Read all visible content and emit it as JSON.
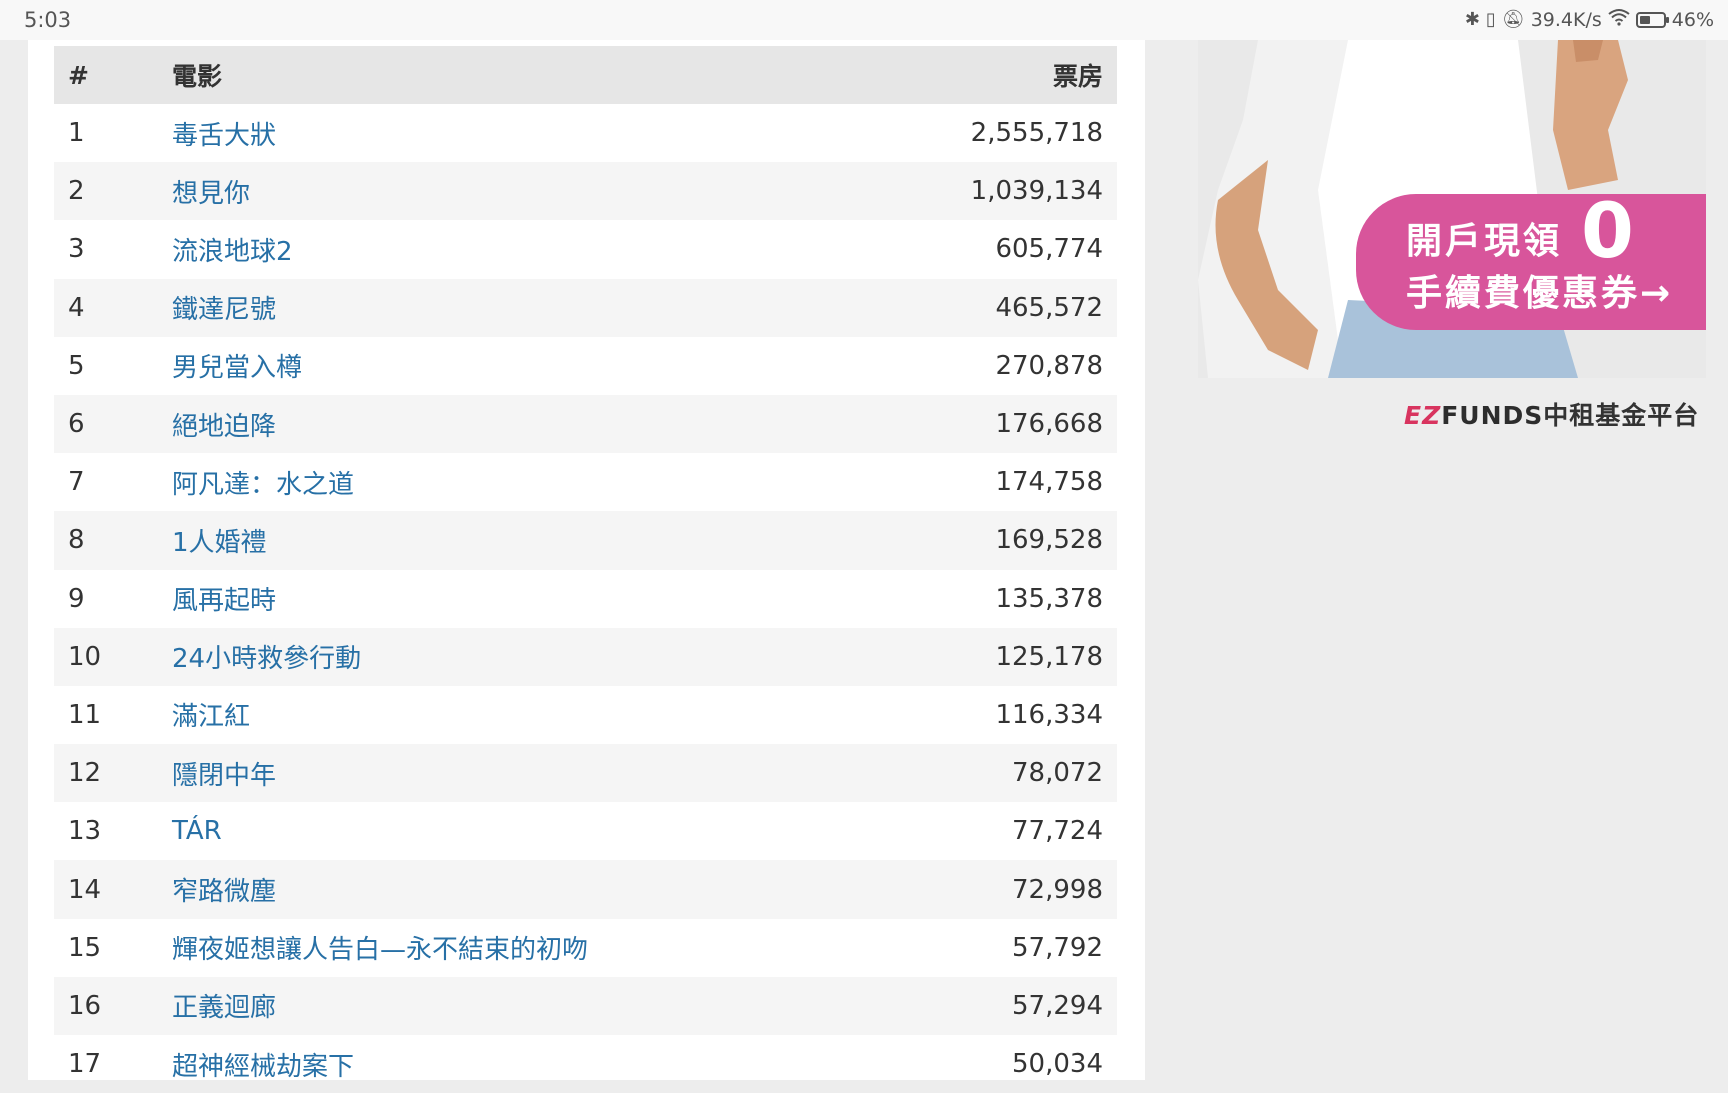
{
  "status_bar": {
    "time": "5:03",
    "network_speed": "39.4K/s",
    "battery": "46%",
    "battery_level": 0.46,
    "icons": [
      "bluetooth-icon",
      "vibrate-icon",
      "mute-icon",
      "wifi-icon",
      "battery-icon"
    ]
  },
  "table": {
    "headers": {
      "rank": "#",
      "title": "電影",
      "gross": "票房"
    },
    "rows": [
      {
        "rank": "1",
        "title": "毒舌大狀",
        "gross": "2,555,718"
      },
      {
        "rank": "2",
        "title": "想見你",
        "gross": "1,039,134"
      },
      {
        "rank": "3",
        "title": "流浪地球2",
        "gross": "605,774"
      },
      {
        "rank": "4",
        "title": "鐵達尼號",
        "gross": "465,572"
      },
      {
        "rank": "5",
        "title": "男兒當入樽",
        "gross": "270,878"
      },
      {
        "rank": "6",
        "title": "絕地迫降",
        "gross": "176,668"
      },
      {
        "rank": "7",
        "title": "阿凡達：水之道",
        "gross": "174,758"
      },
      {
        "rank": "8",
        "title": "1人婚禮",
        "gross": "169,528"
      },
      {
        "rank": "9",
        "title": "風再起時",
        "gross": "135,378"
      },
      {
        "rank": "10",
        "title": "24小時救參行動",
        "gross": "125,178"
      },
      {
        "rank": "11",
        "title": "滿江紅",
        "gross": "116,334"
      },
      {
        "rank": "12",
        "title": "隱閉中年",
        "gross": "78,072"
      },
      {
        "rank": "13",
        "title": "TÁR",
        "gross": "77,724"
      },
      {
        "rank": "14",
        "title": "窄路微塵",
        "gross": "72,998"
      },
      {
        "rank": "15",
        "title": "輝夜姬想讓人告白—永不結束的初吻",
        "gross": "57,792"
      },
      {
        "rank": "16",
        "title": "正義迴廊",
        "gross": "57,294"
      },
      {
        "rank": "17",
        "title": "超神經械劫案下",
        "gross": "50,034"
      }
    ]
  },
  "ad": {
    "promo_line1": "開戶現領",
    "promo_zero": "0",
    "promo_line2": "手續費優惠券→",
    "logo_ez": "EZ",
    "logo_funds": "FUNDS",
    "logo_cn": "中租基金平台",
    "colors": {
      "promo_bg": "#d8559b",
      "logo_accent": "#d8345f"
    }
  },
  "colors": {
    "link": "#2770a6",
    "header_bg": "#e6e6e6",
    "stripe_bg": "#f5f5f5",
    "page_bg": "#ededed"
  }
}
